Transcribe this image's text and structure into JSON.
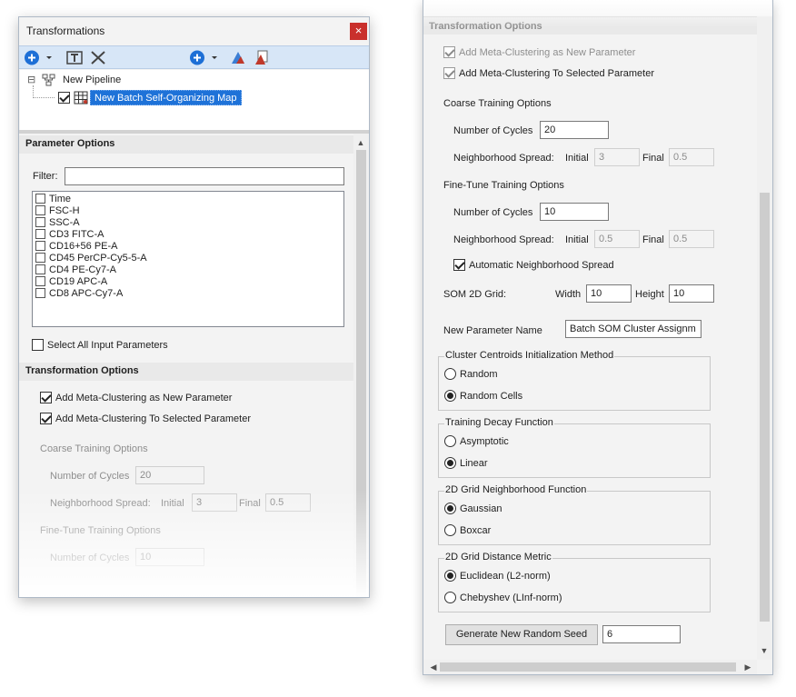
{
  "left_panel": {
    "title": "Transformations",
    "close_glyph": "×",
    "toolbar": {
      "add_icon": "plus-circle-icon",
      "rename_icon": "rename-icon",
      "delete_icon": "x-icon",
      "add2_icon": "plus-circle-icon",
      "gate_icon": "gate-icon",
      "gate_copy_icon": "gate-copy-icon"
    },
    "tree": {
      "expand_glyph": "⊟",
      "pipeline_label": "New Pipeline",
      "item_label": "New Batch Self-Organizing Map"
    },
    "parameter_options": {
      "header": "Parameter Options",
      "filter_label": "Filter:",
      "filter_value": "",
      "parameters": [
        "Time",
        "FSC-H",
        "SSC-A",
        "CD3 FITC-A",
        "CD16+56 PE-A",
        "CD45 PerCP-Cy5-5-A",
        "CD4 PE-Cy7-A",
        "CD19 APC-A",
        "CD8 APC-Cy7-A"
      ],
      "select_all_label": "Select All Input Parameters"
    },
    "transformation_options": {
      "header": "Transformation Options",
      "add_new_param": "Add Meta-Clustering as New Parameter",
      "add_selected_param": "Add Meta-Clustering To Selected Parameter",
      "coarse_header": "Coarse Training Options",
      "cycles_label": "Number of Cycles",
      "coarse_cycles": "20",
      "spread_label": "Neighborhood Spread:",
      "initial_label": "Initial",
      "initial_value": "3",
      "final_label": "Final",
      "final_value": "0.5",
      "finetune_header": "Fine-Tune Training Options",
      "finetune_cycles": "10"
    }
  },
  "right_panel": {
    "header": "Transformation Options",
    "add_new_param": "Add Meta-Clustering as New Parameter",
    "add_selected_param": "Add Meta-Clustering To Selected Parameter",
    "coarse": {
      "header": "Coarse Training Options",
      "cycles_label": "Number of Cycles",
      "cycles": "20",
      "spread_label": "Neighborhood Spread:",
      "initial_label": "Initial",
      "initial": "3",
      "final_label": "Final",
      "final": "0.5"
    },
    "finetune": {
      "header": "Fine-Tune Training Options",
      "cycles_label": "Number of Cycles",
      "cycles": "10",
      "spread_label": "Neighborhood Spread:",
      "initial_label": "Initial",
      "initial": "0.5",
      "final_label": "Final",
      "final": "0.5",
      "auto_spread_label": "Automatic Neighborhood Spread"
    },
    "grid": {
      "label": "SOM 2D Grid:",
      "width_label": "Width",
      "width": "10",
      "height_label": "Height",
      "height": "10"
    },
    "new_param": {
      "label": "New Parameter Name",
      "value": "Batch SOM Cluster Assignm"
    },
    "centroid_init": {
      "title": "Cluster Centroids Initialization Method",
      "options": [
        "Random",
        "Random Cells"
      ],
      "selected": 1
    },
    "decay": {
      "title": "Training Decay Function",
      "options": [
        "Asymptotic",
        "Linear"
      ],
      "selected": 1
    },
    "neighborhood_fn": {
      "title": "2D Grid Neighborhood Function",
      "options": [
        "Gaussian",
        "Boxcar"
      ],
      "selected": 0
    },
    "distance": {
      "title": "2D Grid Distance Metric",
      "options": [
        "Euclidean (L2-norm)",
        "Chebyshev (LInf-norm)"
      ],
      "selected": 0
    },
    "seed": {
      "button_label": "Generate New Random Seed",
      "value": "6"
    },
    "scroll_glyphs": {
      "up": "▲",
      "down": "▼",
      "left": "◀",
      "right": "▶"
    }
  },
  "colors": {
    "selection": "#1e72d8",
    "toolbar": "#d7e6f7",
    "close": "#c9302c"
  }
}
